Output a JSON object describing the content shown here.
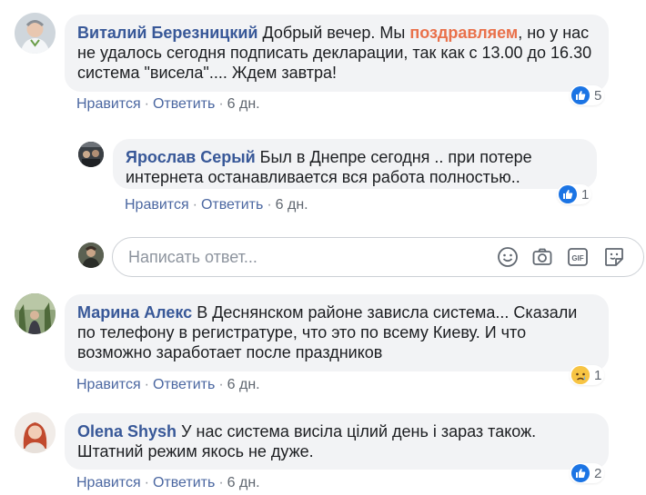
{
  "comments": [
    {
      "author": "Виталий Березницкий",
      "text_pre": "Добрый вечер. Мы ",
      "text_hl": "поздравляем",
      "text_post": ", но у нас не удалось сегодня подписать декларации, так как с 13.00 до 16.30 система \"висела\".... Ждем завтра!",
      "reaction": "like",
      "reaction_count": "5",
      "like_label": "Нравится",
      "reply_label": "Ответить",
      "time": "6 дн."
    },
    {
      "author": "Ярослав Серый",
      "text": "Был в Днепре сегодня .. при потере интернета останавливается вся работа полностью..",
      "reaction": "like",
      "reaction_count": "1",
      "like_label": "Нравится",
      "reply_label": "Ответить",
      "time": "6 дн."
    },
    {
      "author": "Марина Алекс",
      "text": "В Деснянском районе зависла система... Сказали по телефону в регистратуре, что это по всему Киеву. И что возможно заработает после праздников",
      "reaction": "sad",
      "reaction_count": "1",
      "like_label": "Нравится",
      "reply_label": "Ответить",
      "time": "6 дн."
    },
    {
      "author": "Olena Shysh",
      "text": "У нас система висіла цілий день і зараз також. Штатний режим якось не дуже.",
      "reaction": "like",
      "reaction_count": "2",
      "like_label": "Нравится",
      "reply_label": "Ответить",
      "time": "6 дн."
    }
  ],
  "reply_box": {
    "placeholder": "Написать ответ...",
    "tools": [
      "emoji-icon",
      "camera-icon",
      "gif-icon",
      "sticker-icon"
    ]
  },
  "colors": {
    "author": "#385898",
    "highlight": "#e9714b",
    "bubble": "#f2f3f5",
    "like_blue": "#1b74e4",
    "sad_yellow": "#f7c443"
  }
}
